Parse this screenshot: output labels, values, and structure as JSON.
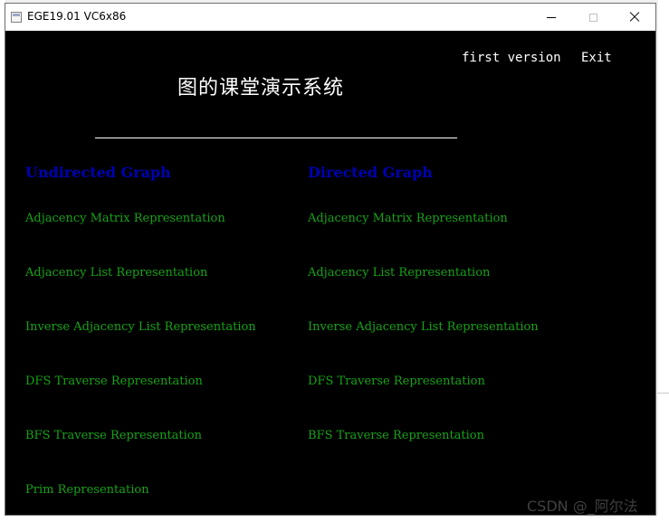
{
  "window": {
    "title": "EGE19.01 VC6x86",
    "controls": {
      "minimize": "minimize",
      "maximize": "maximize",
      "close": "close"
    }
  },
  "header": {
    "first_version": "first version",
    "exit": "Exit",
    "title": "图的课堂演示系统"
  },
  "undirected": {
    "heading": "Undirected Graph",
    "items": [
      "Adjacency Matrix Representation",
      "Adjacency List Representation",
      "Inverse Adjacency List Representation",
      "DFS Traverse Representation",
      "BFS Traverse Representation",
      "Prim Representation"
    ]
  },
  "directed": {
    "heading": "Directed Graph",
    "items": [
      "Adjacency Matrix Representation",
      "Adjacency List Representation",
      "Inverse Adjacency List Representation",
      "DFS Traverse Representation",
      "BFS Traverse Representation"
    ]
  },
  "watermark": "CSDN @_阿尔法",
  "colors": {
    "background": "#000000",
    "heading": "#0000b4",
    "menu_item": "#16a316",
    "text": "#ffffff"
  }
}
